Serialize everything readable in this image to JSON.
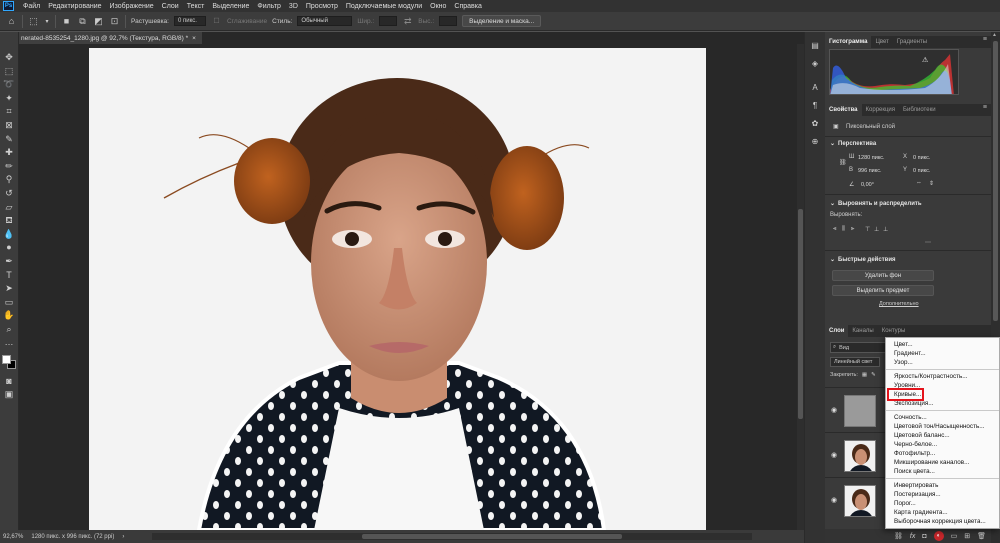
{
  "menubar": {
    "logo": "Ps",
    "items": [
      "Файл",
      "Редактирование",
      "Изображение",
      "Слои",
      "Текст",
      "Выделение",
      "Фильтр",
      "3D",
      "Просмотр",
      "Подключаемые модули",
      "Окно",
      "Справка"
    ]
  },
  "options": {
    "feather_label": "Растушевка:",
    "feather_value": "0 пикс.",
    "antialias_label": "Сглаживание",
    "style_label": "Стиль:",
    "style_value": "Обычный",
    "width_label": "Шир.:",
    "height_label": "Выс.:",
    "select_mask_button": "Выделение и маска..."
  },
  "document": {
    "tab_title": "nerated-8535254_1280.jpg @ 92,7% (Текстура, RGB/8) *",
    "close": "×"
  },
  "status": {
    "zoom": "92,67%",
    "info": "1280 пикс. x 996 пикс. (72 ppi)"
  },
  "histogram_panel": {
    "tabs": [
      "Гистограмма",
      "Цвет",
      "Градиенты"
    ],
    "warning": "⚠"
  },
  "properties_panel": {
    "tabs": [
      "Свойства",
      "Коррекция",
      "Библиотеки"
    ],
    "layer_type": "Пиксельный слой",
    "transform_title": "Перспектива",
    "w_label": "Ш",
    "w_value": "1280 пикс.",
    "h_label": "В",
    "h_value": "996 пикс.",
    "x_label": "X",
    "x_value": "0 пикс.",
    "y_label": "Y",
    "y_value": "0 пикс.",
    "angle_value": "0,00°",
    "align_title": "Выровнять и распределить",
    "align_label": "Выровнять:",
    "quick_title": "Быстрые действия",
    "remove_bg_button": "Удалить фон",
    "select_subject_button": "Выделить предмет",
    "more_link": "Дополнительно"
  },
  "layers_panel": {
    "tabs": [
      "Слои",
      "Каналы",
      "Контуры"
    ],
    "search_placeholder": "Вид",
    "blend_mode": "Линейный свет",
    "lock_label": "Закрепить:",
    "layers": [
      {
        "name": ""
      },
      {
        "name": ""
      },
      {
        "name": ""
      }
    ]
  },
  "adjustment_menu": {
    "group1": [
      "Цвет...",
      "Градиент...",
      "Узор..."
    ],
    "group2": [
      "Яркость/Контрастность...",
      "Уровни...",
      "Кривые...",
      "Экспозиция..."
    ],
    "group3": [
      "Сочность...",
      "Цветовой тон/Насыщенность...",
      "Цветовой баланс...",
      "Черно-белое...",
      "Фотофильтр...",
      "Микширование каналов...",
      "Поиск цвета..."
    ],
    "group4": [
      "Инвертировать",
      "Постеризация...",
      "Порог...",
      "Карта градиента...",
      "Выборочная коррекция цвета..."
    ],
    "highlighted": "Кривые..."
  },
  "colors": {
    "accent_red": "#e4131b",
    "foreground": "#ffffff",
    "background": "#000000"
  }
}
